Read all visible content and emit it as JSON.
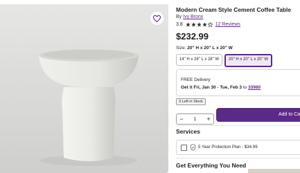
{
  "product": {
    "title": "Modern Cream Style Cement Coffee Table",
    "by_label": "By",
    "brand": "Ivy Bronx",
    "rating": "3.8",
    "rating_stars": 3.8,
    "reviews": "12 Reviews",
    "price": "$232.99"
  },
  "size": {
    "label": "Size:",
    "selected": "20\" H x 20\" L x 20\" W",
    "options": [
      "14\" H x 28\" L x 28\" W",
      "20\" H x 20\" L x 20\" W"
    ]
  },
  "delivery": {
    "title": "FREE Delivery",
    "get_it": "Get it Fri, Jan 30 - Tue, Feb 3",
    "to": "to",
    "zip": "33980"
  },
  "stock": "3 Left in Stock",
  "quantity": {
    "minus": "−",
    "value": "1",
    "plus": "+"
  },
  "add_to_cart": "Add to Cart",
  "services": {
    "heading": "Services",
    "plan": "5 Year Protection Plan - $34.99"
  },
  "section_heading": "Get Everything You Need",
  "colors": {
    "accent": "#5b2a86",
    "background": "#dcdcdc"
  },
  "icons": {
    "favorite": "heart-icon",
    "star": "star-icon",
    "plan": "shield-icon"
  }
}
